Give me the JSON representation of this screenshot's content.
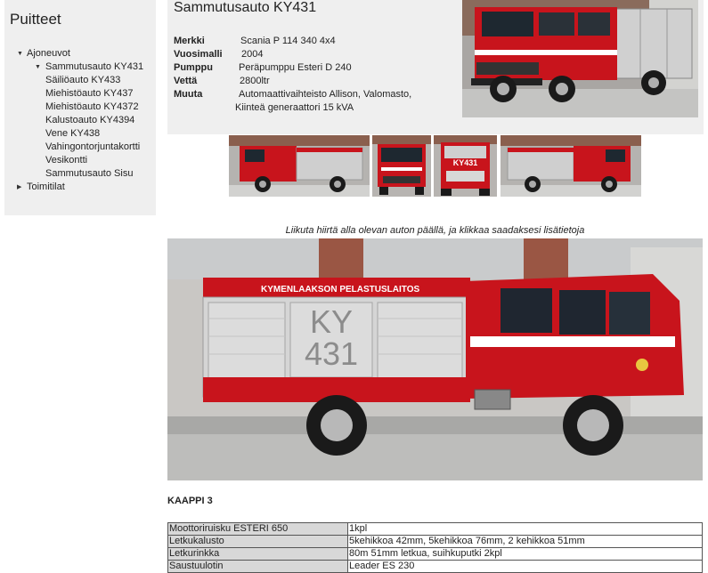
{
  "sidebar": {
    "title": "Puitteet",
    "items": [
      {
        "label": "Ajoneuvot",
        "level": 1,
        "expanded": true
      },
      {
        "label": "Sammutusauto KY431",
        "level": 2
      },
      {
        "label": "Säiliöauto KY433",
        "level": 2
      },
      {
        "label": "Miehistöauto KY437",
        "level": 2
      },
      {
        "label": "Miehistöauto KY4372",
        "level": 2
      },
      {
        "label": "Kalustoauto KY4394",
        "level": 2
      },
      {
        "label": "Vene KY438",
        "level": 2
      },
      {
        "label": "Vahingontorjuntakortti",
        "level": 2
      },
      {
        "label": "Vesikontti",
        "level": 2
      },
      {
        "label": "Sammutusauto Sisu",
        "level": 2
      },
      {
        "label": "Toimitilat",
        "level": 1,
        "expanded": false
      }
    ]
  },
  "vehicle": {
    "title": "Sammutusauto KY431",
    "specs": [
      {
        "key": "Merkki",
        "value": "Scania P 114  340 4x4"
      },
      {
        "key": "Vuosimalli",
        "value": "2004"
      },
      {
        "key": "Pumppu",
        "value": "Peräpumppu Esteri D 240"
      },
      {
        "key": "Vettä",
        "value": "2800ltr"
      },
      {
        "key": "Muuta",
        "value": "Automaattivaihteisto Allison, Valomasto,"
      }
    ],
    "specs_continuation": "Kiinteä generaattori 15 kVA"
  },
  "truck": {
    "body_text": "KYMENLAAKSON PELASTUSLAITOS",
    "id_line1": "KY",
    "id_line2": "431",
    "rear_id": "KY431"
  },
  "hint": "Liikuta hiirtä alla olevan auton päällä, ja klikkaa saadaksesi lisätietoja",
  "section": {
    "title": "KAAPPI 3",
    "rows": [
      {
        "item": "Moottoriruisku ESTERI 650",
        "qty": "1kpl"
      },
      {
        "item": "Letkukalusto",
        "qty": "5kehikkoa 42mm, 5kehikkoa 76mm, 2 kehikkoa 51mm"
      },
      {
        "item": "Letkurinkka",
        "qty": "80m 51mm letkua, suihkuputki 2kpl"
      },
      {
        "item": "Saustuulotin",
        "qty": "Leader ES 230"
      }
    ]
  },
  "colors": {
    "truck_red": "#c8141c",
    "panel_bg": "#efefef",
    "table_label_bg": "#d8d8d8"
  }
}
